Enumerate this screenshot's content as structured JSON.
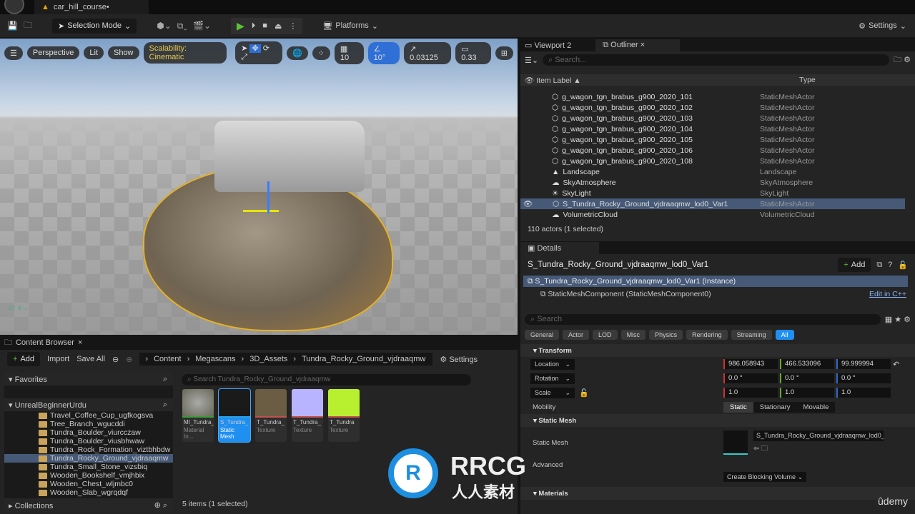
{
  "app": {
    "doc_title": "car_hill_course•"
  },
  "toolbar": {
    "selection_mode": "Selection Mode",
    "platforms": "Platforms",
    "settings": "Settings"
  },
  "viewport": {
    "perspective": "Perspective",
    "lit": "Lit",
    "show": "Show",
    "scalability": "Scalability: Cinematic",
    "grid_snap": "10",
    "rot_snap": "10°",
    "scale_snap": "0.03125",
    "camera_speed": "0.33"
  },
  "outliner": {
    "tabs": [
      "Viewport 2",
      "Outliner"
    ],
    "search_placeholder": "Search...",
    "col_label": "Item Label ▲",
    "col_type": "Type",
    "rows": [
      {
        "label": "g_wagon_tgn_brabus_g900_2020_101",
        "type": "StaticMeshActor",
        "icon": "mesh"
      },
      {
        "label": "g_wagon_tgn_brabus_g900_2020_102",
        "type": "StaticMeshActor",
        "icon": "mesh"
      },
      {
        "label": "g_wagon_tgn_brabus_g900_2020_103",
        "type": "StaticMeshActor",
        "icon": "mesh"
      },
      {
        "label": "g_wagon_tgn_brabus_g900_2020_104",
        "type": "StaticMeshActor",
        "icon": "mesh"
      },
      {
        "label": "g_wagon_tgn_brabus_g900_2020_105",
        "type": "StaticMeshActor",
        "icon": "mesh"
      },
      {
        "label": "g_wagon_tgn_brabus_g900_2020_106",
        "type": "StaticMeshActor",
        "icon": "mesh"
      },
      {
        "label": "g_wagon_tgn_brabus_g900_2020_108",
        "type": "StaticMeshActor",
        "icon": "mesh"
      },
      {
        "label": "Landscape",
        "type": "Landscape",
        "icon": "landscape"
      },
      {
        "label": "SkyAtmosphere",
        "type": "SkyAtmosphere",
        "icon": "sky"
      },
      {
        "label": "SkyLight",
        "type": "SkyLight",
        "icon": "light"
      },
      {
        "label": "S_Tundra_Rocky_Ground_vjdraaqmw_lod0_Var1",
        "type": "StaticMeshActor",
        "icon": "mesh",
        "selected": true
      },
      {
        "label": "VolumetricCloud",
        "type": "VolumetricCloud",
        "icon": "cloud"
      }
    ],
    "footer": "110 actors (1 selected)"
  },
  "details": {
    "tab": "Details",
    "title": "S_Tundra_Rocky_Ground_vjdraaqmw_lod0_Var1",
    "add": "Add",
    "instance": "S_Tundra_Rocky_Ground_vjdraaqmw_lod0_Var1 (Instance)",
    "component": "StaticMeshComponent (StaticMeshComponent0)",
    "edit_cpp": "Edit in C++",
    "search_placeholder": "Search",
    "filters": [
      "General",
      "Actor",
      "LOD",
      "Misc",
      "Physics",
      "Rendering",
      "Streaming",
      "All"
    ],
    "transform": {
      "header": "Transform",
      "location_label": "Location",
      "location": [
        "986.058943",
        "466.533096",
        "99.999994"
      ],
      "rotation_label": "Rotation",
      "rotation": [
        "0.0 °",
        "0.0 °",
        "0.0 °"
      ],
      "scale_label": "Scale",
      "scale": [
        "1.0",
        "1.0",
        "1.0"
      ],
      "mobility_label": "Mobility",
      "mobility": [
        "Static",
        "Stationary",
        "Movable"
      ]
    },
    "static_mesh": {
      "header": "Static Mesh",
      "label": "Static Mesh",
      "value": "S_Tundra_Rocky_Ground_vjdraaqmw_lod0_Va",
      "advanced": "Advanced",
      "blocking": "Create Blocking Volume"
    },
    "materials": "Materials"
  },
  "content_browser": {
    "tab": "Content Browser",
    "add": "Add",
    "import": "Import",
    "save_all": "Save All",
    "settings": "Settings",
    "breadcrumb": [
      "Content",
      "Megascans",
      "3D_Assets",
      "Tundra_Rocky_Ground_vjdraaqmw"
    ],
    "favorites": "Favorites",
    "project": "UnrealBeginnerUrdu",
    "collections": "Collections",
    "folders": [
      "Travel_Coffee_Cup_ugfkogsva",
      "Tree_Branch_wgucddi",
      "Tundra_Boulder_viurcczaw",
      "Tundra_Boulder_viusbhwaw",
      "Tundra_Rock_Formation_viztbhbdw",
      "Tundra_Rocky_Ground_vjdraaqmw",
      "Tundra_Small_Stone_vizsbiq",
      "Wooden_Bookshelf_vmjhbix",
      "Wooden_Chest_wljmbc0",
      "Wooden_Slab_wgrqdqf"
    ],
    "selected_folder": 5,
    "search_placeholder": "Search Tundra_Rocky_Ground_vjdraaqmw",
    "assets": [
      {
        "name": "MI_Tundra_",
        "type": "Material In...",
        "color": "#3a9a3a"
      },
      {
        "name": "S_Tundra_",
        "type": "Static Mesh",
        "color": "#29a3e6"
      },
      {
        "name": "T_Tundra_",
        "type": "Texture",
        "color": "#c05050"
      },
      {
        "name": "T_Tundra_",
        "type": "Texture",
        "color": "#c05050"
      },
      {
        "name": "T_Tundra",
        "type": "Texture",
        "color": "#c05050"
      }
    ],
    "status": "5 items (1 selected)"
  },
  "watermark": {
    "brand": "RRCG",
    "sub": "人人素材",
    "udemy": "ûdemy"
  }
}
